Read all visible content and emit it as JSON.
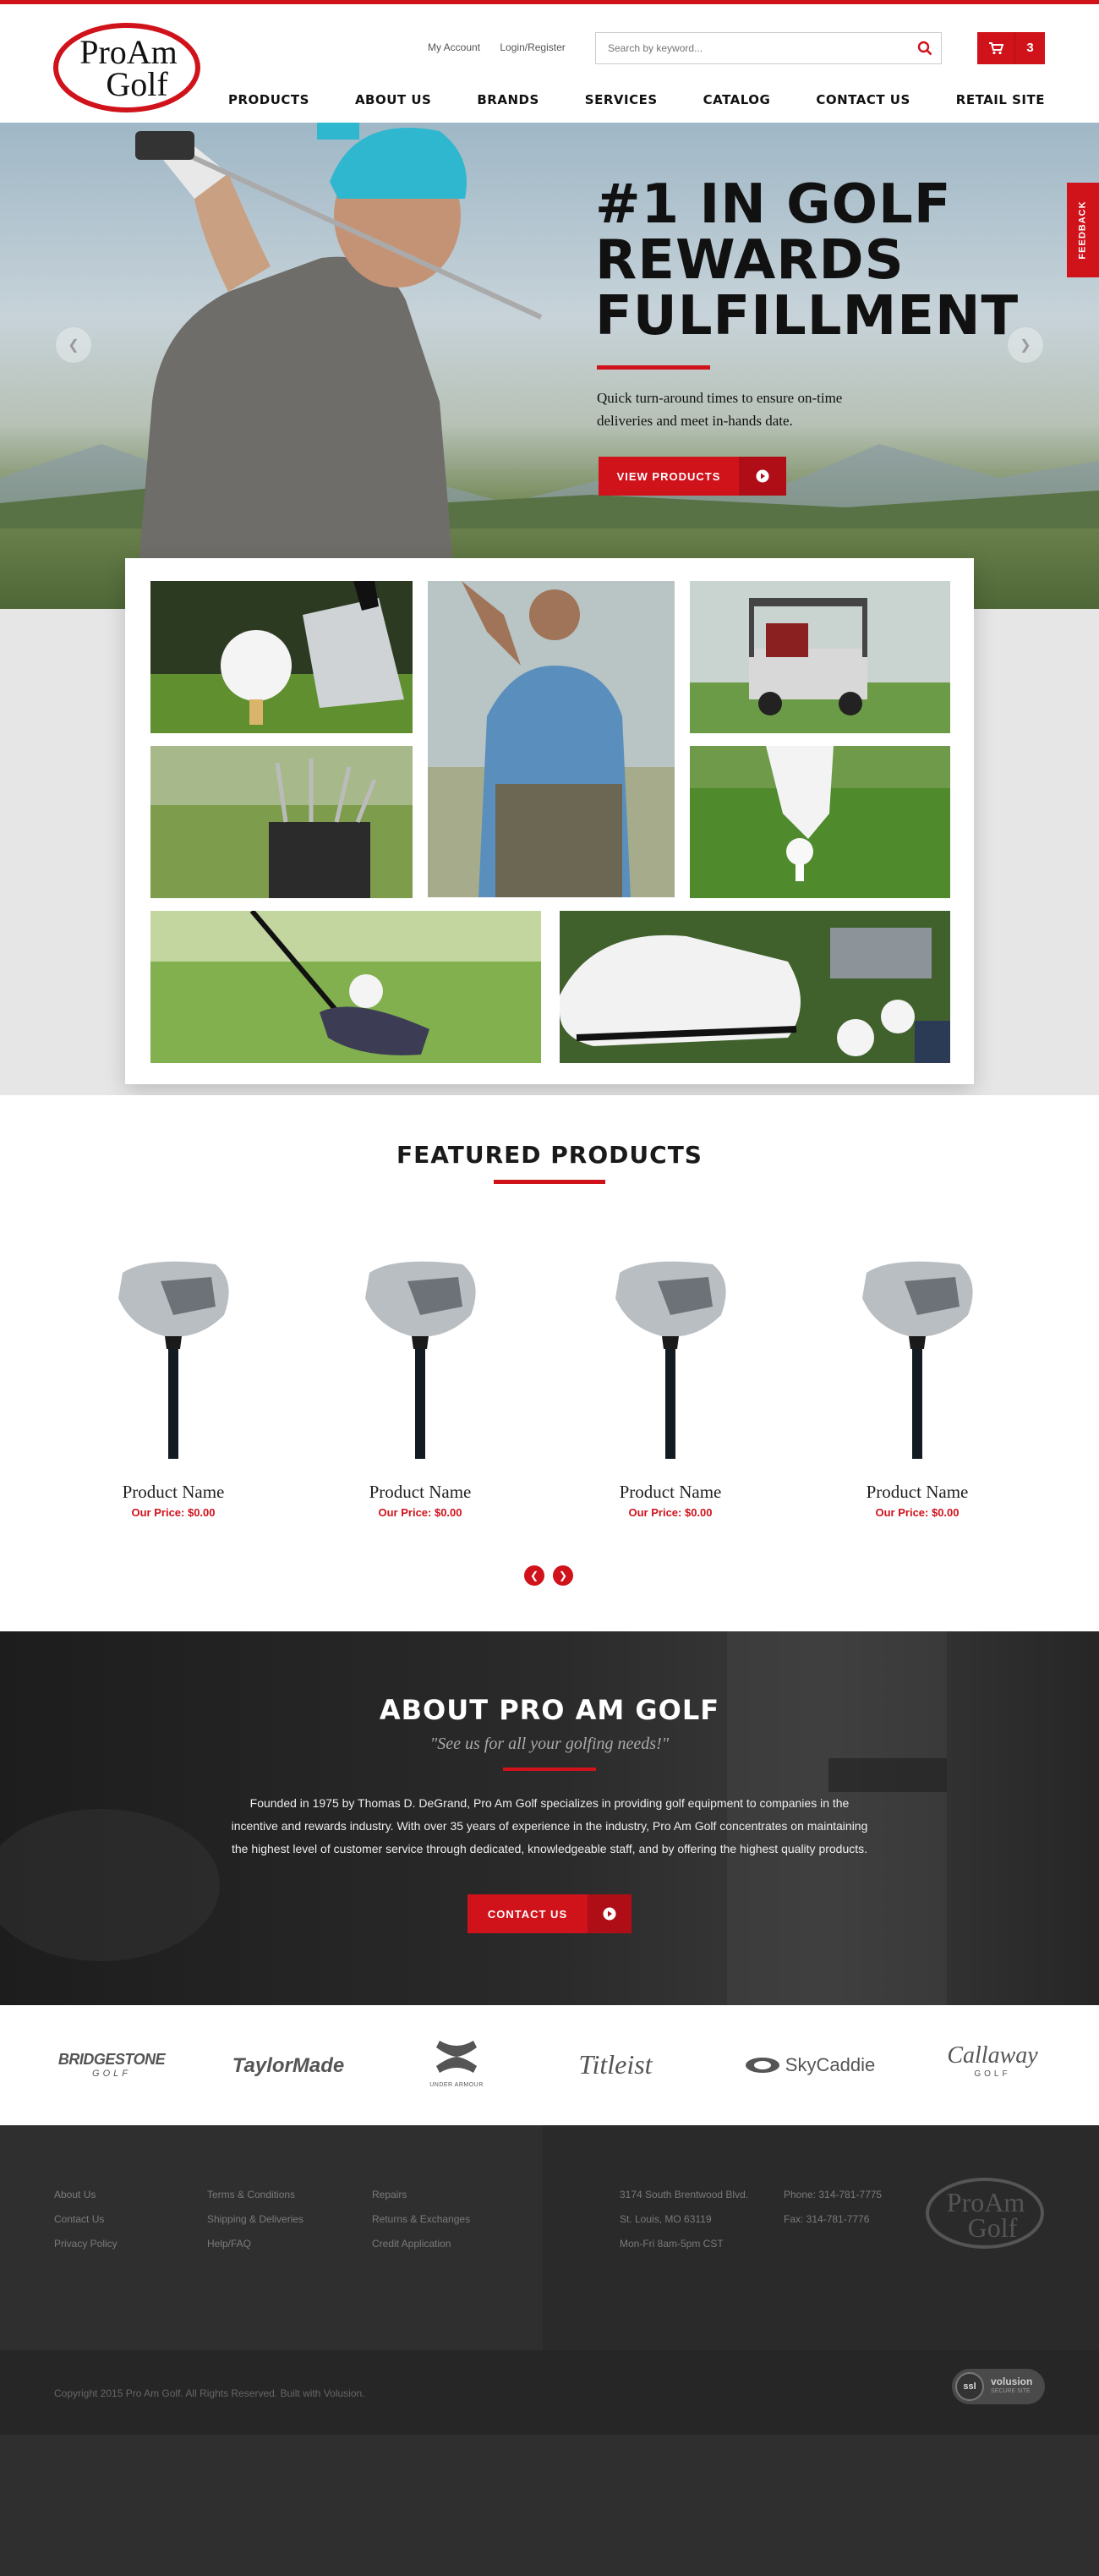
{
  "header": {
    "logo_line1": "ProAm",
    "logo_line2": "Golf",
    "my_account": "My Account",
    "login_register": "Login/Register",
    "search_placeholder": "Search by keyword...",
    "cart_count": "3"
  },
  "nav": {
    "items": [
      "PRODUCTS",
      "ABOUT US",
      "BRANDS",
      "SERVICES",
      "CATALOG",
      "CONTACT US",
      "RETAIL SITE"
    ]
  },
  "hero": {
    "title_line1": "#1 IN GOLF",
    "title_line2": "REWARDS",
    "title_line3": "FULFILLMENT",
    "subtitle": "Quick turn-around times to ensure on-time deliveries and meet in-hands date.",
    "button_label": "VIEW PRODUCTS"
  },
  "feedback_label": "FEEDBACK",
  "featured": {
    "heading": "FEATURED PRODUCTS",
    "products": [
      {
        "name": "Product Name",
        "price": "Our Price: $0.00"
      },
      {
        "name": "Product Name",
        "price": "Our Price: $0.00"
      },
      {
        "name": "Product Name",
        "price": "Our Price: $0.00"
      },
      {
        "name": "Product Name",
        "price": "Our Price: $0.00"
      }
    ]
  },
  "about": {
    "heading": "ABOUT PRO AM GOLF",
    "tagline": "\"See us for all your golfing needs!\"",
    "body": "Founded in 1975 by Thomas D. DeGrand, Pro Am Golf specializes in providing golf equipment to companies in the incentive and rewards industry. With over 35 years of experience in the industry, Pro Am Golf concentrates on maintaining the highest level of customer service through dedicated, knowledgeable staff, and by offering the highest quality products.",
    "button_label": "CONTACT US"
  },
  "brands": {
    "bridgestone_1": "BRIDGESTONE",
    "bridgestone_2": "GOLF",
    "taylormade": "TaylorMade",
    "underarmour": "UNDER ARMOUR",
    "titleist": "Titleist",
    "skycaddie": "SkyCaddie",
    "callaway_1": "Callaway",
    "callaway_2": "GOLF"
  },
  "footer": {
    "col1": [
      "About Us",
      "Contact Us",
      "Privacy Policy"
    ],
    "col2": [
      "Terms & Conditions",
      "Shipping & Deliveries",
      "Help/FAQ"
    ],
    "col3": [
      "Repairs",
      "Returns & Exchanges",
      "Credit Application"
    ],
    "address": [
      "3174 South Brentwood Blvd.",
      "St. Louis, MO 63119",
      "Mon-Fri 8am-5pm CST"
    ],
    "phone": "Phone: 314-781-7775",
    "fax": "Fax: 314-781-7776",
    "logo_line1": "ProAm",
    "logo_line2": "Golf",
    "copyright": "Copyright 2015 Pro Am Golf. All Rights Reserved. Built with Volusion.",
    "ssl_label": "ssl",
    "ssl_brand": "volusion",
    "ssl_sub": "SECURE SITE"
  },
  "colors": {
    "brand_red": "#d0121b",
    "dark": "#2f2f2f"
  }
}
